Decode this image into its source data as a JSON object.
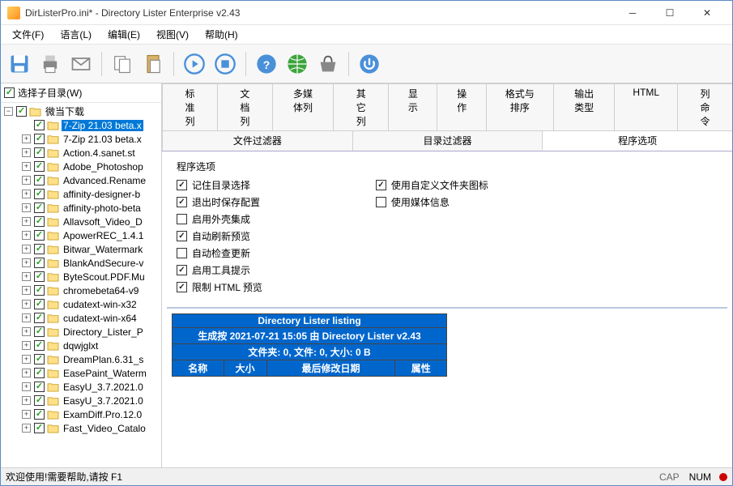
{
  "title": "DirListerPro.ini* - Directory Lister Enterprise v2.43",
  "menu": [
    "文件(F)",
    "语言(L)",
    "编辑(E)",
    "视图(V)",
    "帮助(H)"
  ],
  "leftHeader": "选择子目录(W)",
  "treeRoot": "微当下载",
  "treeItems": [
    {
      "label": "7-Zip 21.03 beta.x",
      "selected": true
    },
    {
      "label": "7-Zip 21.03 beta.x"
    },
    {
      "label": "Action.4.sanet.st"
    },
    {
      "label": "Adobe_Photoshop"
    },
    {
      "label": "Advanced.Rename"
    },
    {
      "label": "affinity-designer-b"
    },
    {
      "label": "affinity-photo-beta"
    },
    {
      "label": "Allavsoft_Video_D"
    },
    {
      "label": "ApowerREC_1.4.1"
    },
    {
      "label": "Bitwar_Watermark"
    },
    {
      "label": "BlankAndSecure-v"
    },
    {
      "label": "ByteScout.PDF.Mu"
    },
    {
      "label": "chromebeta64-v9"
    },
    {
      "label": "cudatext-win-x32"
    },
    {
      "label": "cudatext-win-x64"
    },
    {
      "label": "Directory_Lister_P"
    },
    {
      "label": "dqwjglxt"
    },
    {
      "label": "DreamPlan.6.31_s"
    },
    {
      "label": "EasePaint_Waterm"
    },
    {
      "label": "EasyU_3.7.2021.0"
    },
    {
      "label": "EasyU_3.7.2021.0"
    },
    {
      "label": "ExamDiff.Pro.12.0"
    },
    {
      "label": "Fast_Video_Catalo"
    }
  ],
  "tabsRow1": [
    "标准列",
    "文档列",
    "多媒体列",
    "其它列",
    "显示",
    "操作",
    "格式与排序",
    "输出类型",
    "HTML",
    "列命令"
  ],
  "tabsRow2": [
    "文件过滤器",
    "目录过滤器",
    "程序选项"
  ],
  "activeTab": "程序选项",
  "optionsTitle": "程序选项",
  "optionsCol1": [
    {
      "label": "记住目录选择",
      "checked": true
    },
    {
      "label": "退出时保存配置",
      "checked": true
    },
    {
      "label": "启用外壳集成",
      "checked": false
    },
    {
      "label": "自动刷新预览",
      "checked": true
    },
    {
      "label": "自动检查更新",
      "checked": false
    },
    {
      "label": "启用工具提示",
      "checked": true
    },
    {
      "label": "限制 HTML 预览",
      "checked": true
    }
  ],
  "optionsCol2": [
    {
      "label": "使用自定义文件夹图标",
      "checked": true
    },
    {
      "label": "使用媒体信息",
      "checked": false
    }
  ],
  "listing": {
    "title": "Directory Lister listing",
    "subtitle": "生成按 2021-07-21 15:05 由 Directory Lister v2.43",
    "summary": "文件夹: 0, 文件: 0, 大小: 0 B",
    "cols": [
      "名称",
      "大小",
      "最后修改日期",
      "属性"
    ]
  },
  "status": "欢迎使用!需要帮助,请按 F1",
  "cap": "CAP",
  "num": "NUM"
}
